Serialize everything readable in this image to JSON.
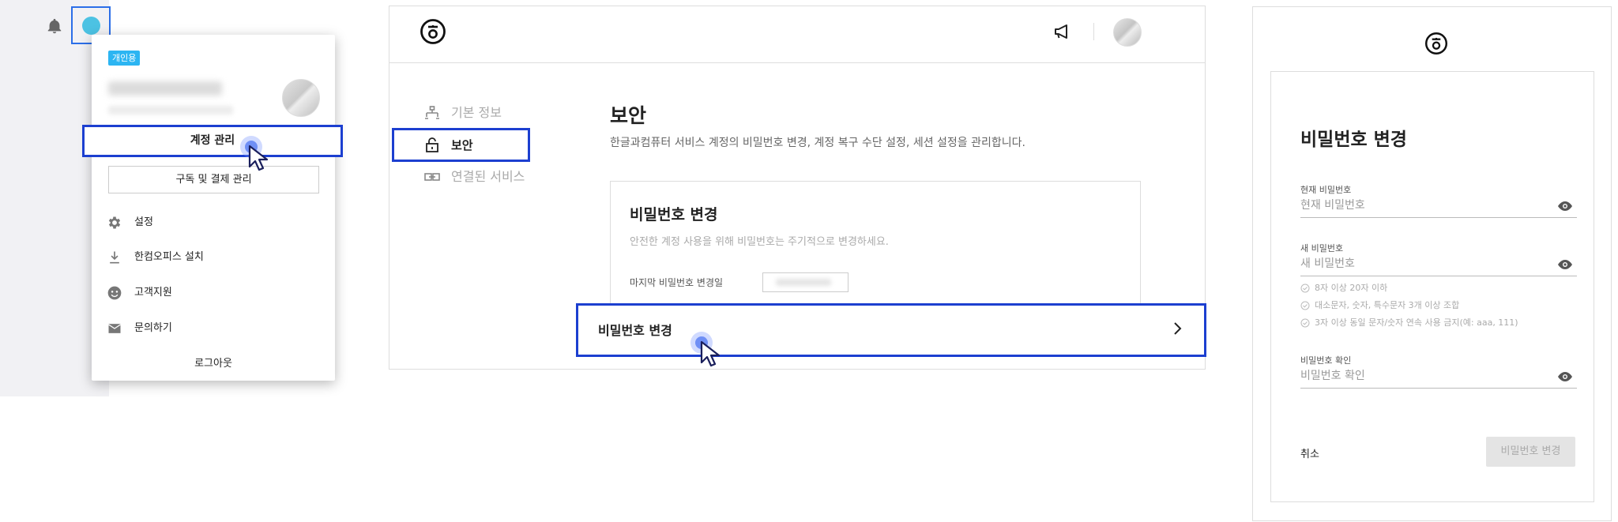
{
  "panel1": {
    "badge": "개인용",
    "manage_account": "계정 관리",
    "subscription": "구독 및 결제 관리",
    "menu": [
      {
        "label": "설정",
        "icon": "gear-icon"
      },
      {
        "label": "한컴오피스 설치",
        "icon": "download-icon"
      },
      {
        "label": "고객지원",
        "icon": "smiley-icon"
      },
      {
        "label": "문의하기",
        "icon": "mail-icon"
      }
    ],
    "logout": "로그아웃"
  },
  "panel2": {
    "nav": [
      {
        "label": "기본 정보",
        "icon": "person-network-icon"
      },
      {
        "label": "보안",
        "icon": "lock-icon"
      },
      {
        "label": "연결된 서비스",
        "icon": "link-icon"
      }
    ],
    "section_title": "보안",
    "section_desc": "한글과컴퓨터 서비스 계정의 비밀번호 변경, 계정 복구 수단 설정, 세션 설정을 관리합니다.",
    "card_title": "비밀번호 변경",
    "card_desc": "안전한 계정 사용을 위해 비밀번호는 주기적으로 변경하세요.",
    "last_changed_label": "마지막 비밀번호 변경일",
    "change_button": "비밀번호 변경"
  },
  "panel3": {
    "title": "비밀번호 변경",
    "current": {
      "label": "현재 비밀번호",
      "placeholder": "현재 비밀번호"
    },
    "new": {
      "label": "새 비밀번호",
      "placeholder": "새 비밀번호"
    },
    "rules": [
      "8자 이상 20자 이하",
      "대소문자, 숫자, 특수문자 3개 이상 조합",
      "3자 이상 동일 문자/숫자 연속 사용 금지(예: aaa, 111)"
    ],
    "confirm": {
      "label": "비밀번호 확인",
      "placeholder": "비밀번호 확인"
    },
    "cancel": "취소",
    "submit": "비밀번호 변경"
  },
  "colors": {
    "highlight": "#1c3fd0",
    "badge": "#2cb5f2",
    "avatar": "#4cc2e3"
  }
}
